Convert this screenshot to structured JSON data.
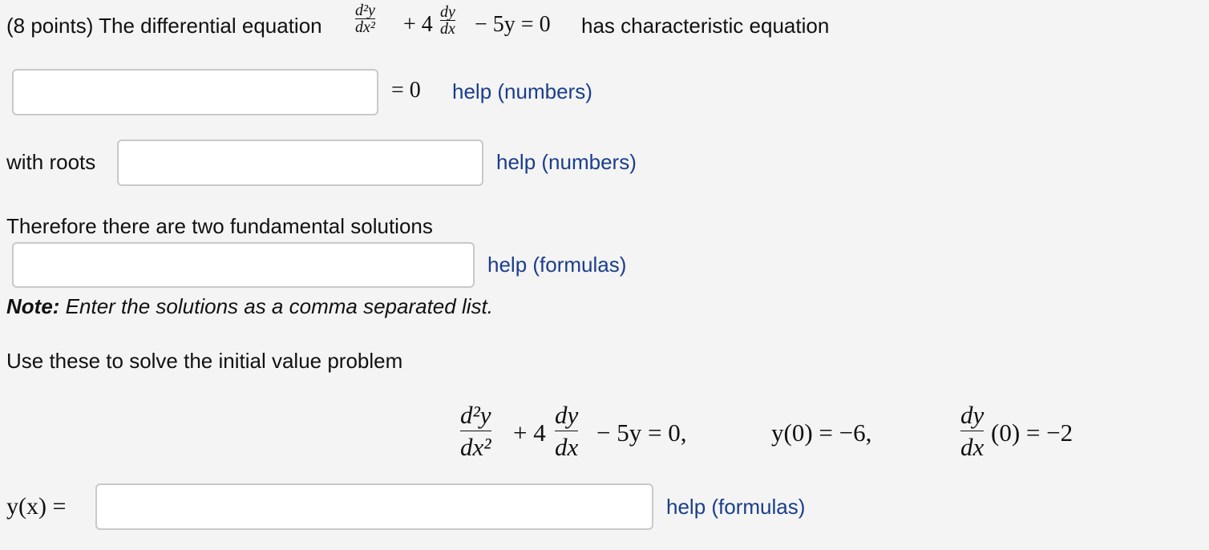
{
  "intro": {
    "points": "(8 points) The differential equation",
    "eq_plus4": "+ 4",
    "eq_rest": "− 5y = 0",
    "suffix": "has characteristic equation"
  },
  "char_eq": {
    "value": "",
    "equals": "= 0",
    "help": "help (numbers)"
  },
  "roots": {
    "label": "with roots",
    "value": "",
    "help": "help (numbers)"
  },
  "fundamental": {
    "text": "Therefore there are two fundamental solutions",
    "value": "",
    "help": "help (formulas)",
    "note_bold": "Note:",
    "note_text": "Enter the solutions as a comma separated list."
  },
  "ivp": {
    "text": "Use these to solve the initial value problem",
    "plus4": "+ 4",
    "rest": "− 5y = 0,",
    "cond1": "y(0) = −6,",
    "cond2": "(0) = −2"
  },
  "answer": {
    "label": "y(x) =",
    "value": "",
    "help": "help (formulas)"
  },
  "frac": {
    "d2y": "d²y",
    "dx2": "dx²",
    "dy": "dy",
    "dx": "dx"
  }
}
